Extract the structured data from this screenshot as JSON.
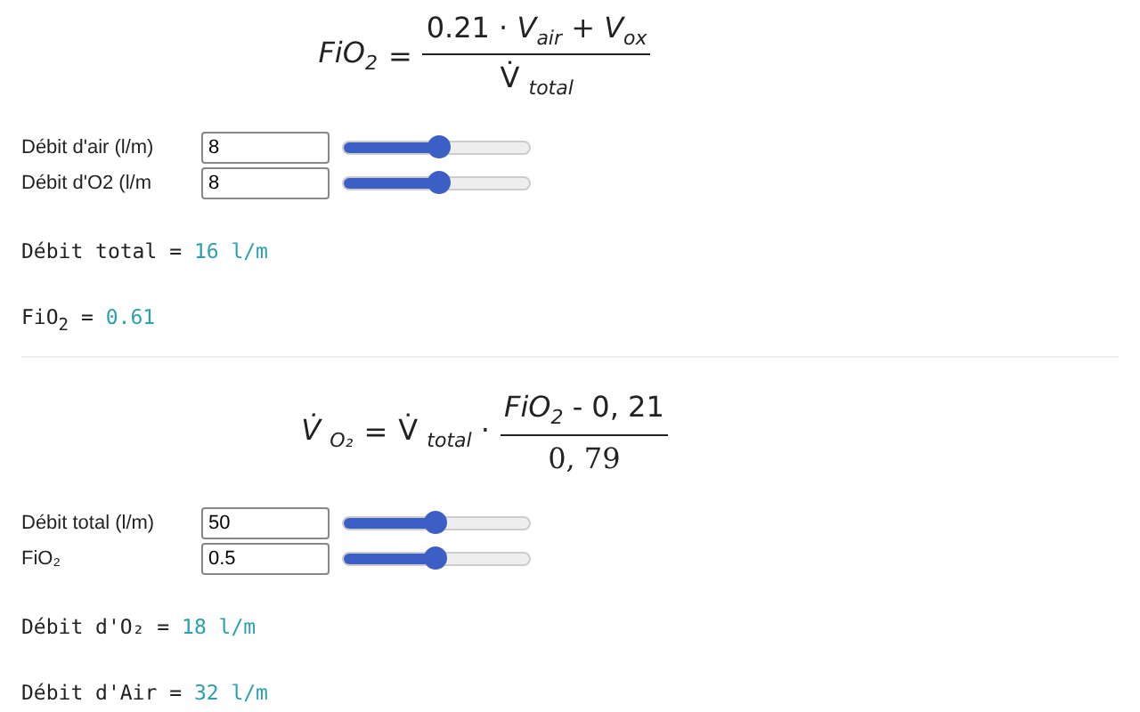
{
  "sections": [
    {
      "formula": {
        "kind": "fio2",
        "lhs": "*FiO*$_{2}$",
        "equals": "=",
        "numerator": "0.21 · *V*$_{air}$ + *V*$_{ox}$",
        "denominator": "V̇ $_{total}$"
      },
      "controls": [
        {
          "label": "Débit d'air (l/m)",
          "value": "8",
          "level": 0.52
        },
        {
          "label": "Débit d'O2 (l/m",
          "value": "8",
          "level": 0.52
        }
      ],
      "outputs": [
        {
          "label": "Débit total = ",
          "value": "16 l/m"
        },
        {
          "label": "FiO$_{2}$ = ",
          "value": "0.61"
        }
      ]
    },
    {
      "formula": {
        "kind": "vo2",
        "lhs": "V̇ $_{O₂}$",
        "equals": "=",
        "prefix": "V̇ $_{total}$ ·",
        "numerator": "*FiO*$_{2}$ - 0, 21",
        "denominator": "0, 79"
      },
      "controls": [
        {
          "label": "Débit total (l/m)",
          "value": "50",
          "level": 0.5
        },
        {
          "label": "FiO₂",
          "value": "0.5",
          "level": 0.5
        }
      ],
      "outputs": [
        {
          "label": "Débit d'O₂ = ",
          "value": "18 l/m"
        },
        {
          "label": "Débit d'Air = ",
          "value": "32 l/m"
        }
      ]
    }
  ]
}
